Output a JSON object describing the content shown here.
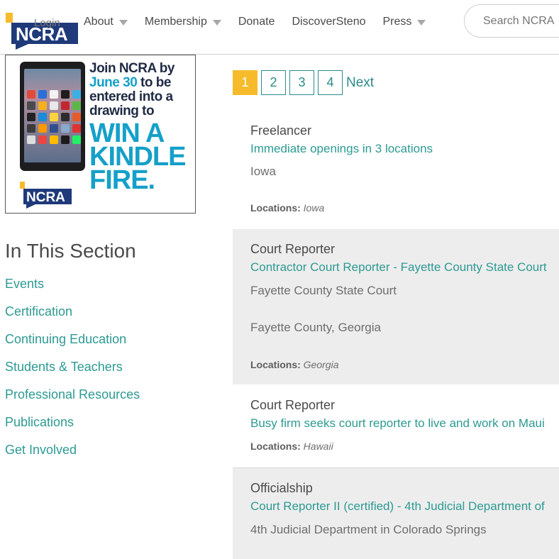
{
  "header": {
    "login_label": "Login",
    "nav": [
      {
        "label": "About",
        "has_dropdown": true
      },
      {
        "label": "Membership",
        "has_dropdown": true
      },
      {
        "label": "Donate",
        "has_dropdown": false
      },
      {
        "label": "DiscoverSteno",
        "has_dropdown": false
      },
      {
        "label": "Press",
        "has_dropdown": true
      }
    ],
    "search_placeholder": "Search NCRA",
    "logo_text": "NCRA"
  },
  "ad": {
    "line1": "Join NCRA by",
    "line2_highlight": "June 30",
    "line2_rest": " to be",
    "line3": "entered into a",
    "line4": "drawing to",
    "big1": "WIN A",
    "big2": "KINDLE",
    "big3": "FIRE.",
    "logo_text": "NCRA"
  },
  "sidebar": {
    "title": "In This Section",
    "links": [
      "Events",
      "Certification",
      "Continuing Education",
      "Students & Teachers",
      "Professional Resources",
      "Publications",
      "Get Involved"
    ]
  },
  "pagination": {
    "pages": [
      "1",
      "2",
      "3",
      "4"
    ],
    "current": "1",
    "next_label": "Next"
  },
  "jobs": [
    {
      "category": "Freelancer",
      "title": "Immediate openings in 3 locations",
      "lines": [
        "Iowa"
      ],
      "locations_label": "Locations:",
      "locations_value": "Iowa"
    },
    {
      "category": "Court Reporter",
      "title": "Contractor Court Reporter - Fayette County State Court",
      "lines": [
        "Fayette County State Court",
        "Fayette County, Georgia"
      ],
      "locations_label": "Locations:",
      "locations_value": "Georgia"
    },
    {
      "category": "Court Reporter",
      "title": "Busy firm seeks court reporter to live and work on Maui",
      "lines": [],
      "locations_label": "Locations:",
      "locations_value": "Hawaii"
    },
    {
      "category": "Officialship",
      "title": "Court Reporter II (certified) - 4th Judicial Department of",
      "lines": [
        "4th Judicial Department in Colorado Springs"
      ],
      "locations_label": "",
      "locations_value": ""
    }
  ],
  "colors": {
    "accent_teal": "#2d9a93",
    "accent_yellow": "#f6bb2a",
    "logo_navy": "#1f3a7a",
    "ad_blue": "#15a0c9"
  }
}
